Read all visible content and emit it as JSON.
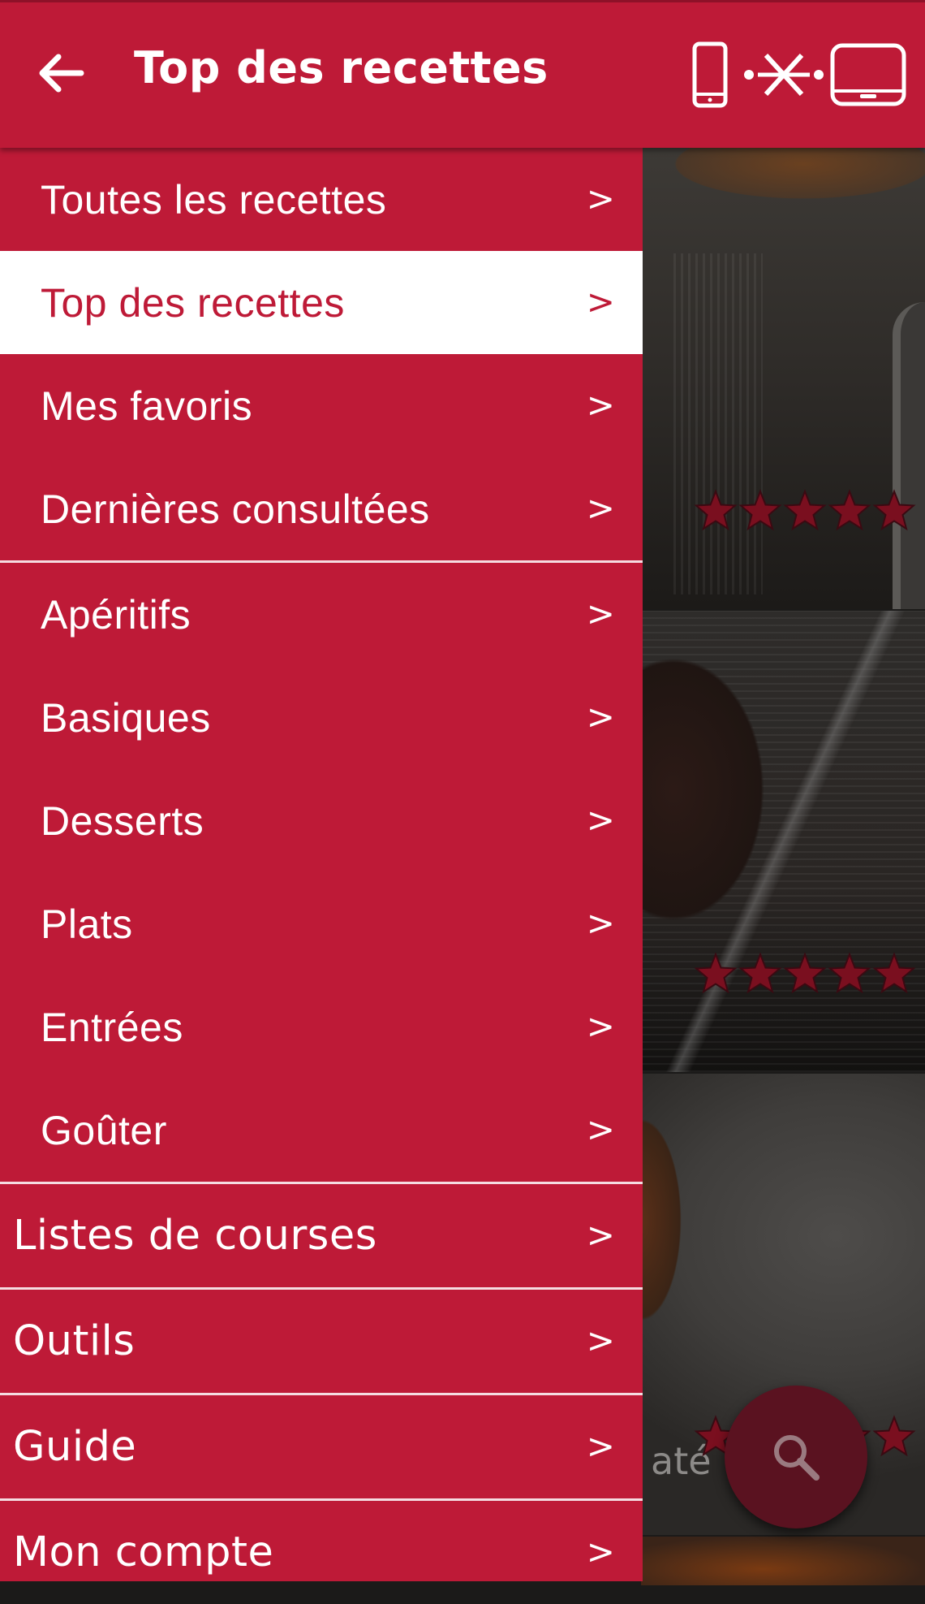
{
  "appbar": {
    "title": "Top des recettes",
    "back_icon": "arrow-left-icon",
    "device_icons": [
      "phone-icon",
      "link-icon",
      "tablet-icon"
    ]
  },
  "colors": {
    "brand_red": "#be1a37",
    "active_bg": "#ffffff",
    "star": "#7a0f1f",
    "fab": "#5a1220"
  },
  "menu": {
    "chevron": ">",
    "recipes": [
      {
        "label": "Toutes les recettes",
        "active": false
      },
      {
        "label": "Top des recettes",
        "active": true
      },
      {
        "label": "Mes favoris",
        "active": false
      },
      {
        "label": "Dernières consultées",
        "active": false
      }
    ],
    "categories": [
      {
        "label": "Apéritifs"
      },
      {
        "label": "Basiques"
      },
      {
        "label": "Desserts"
      },
      {
        "label": "Plats"
      },
      {
        "label": "Entrées"
      },
      {
        "label": "Goûter"
      }
    ],
    "sections": [
      {
        "label": "Listes de courses"
      },
      {
        "label": "Outils"
      },
      {
        "label": "Guide"
      },
      {
        "label": "Mon compte"
      }
    ]
  },
  "background": {
    "card_fragment_text": "até",
    "ratings": [
      5,
      5,
      5
    ]
  },
  "fab": {
    "icon": "search-icon"
  }
}
